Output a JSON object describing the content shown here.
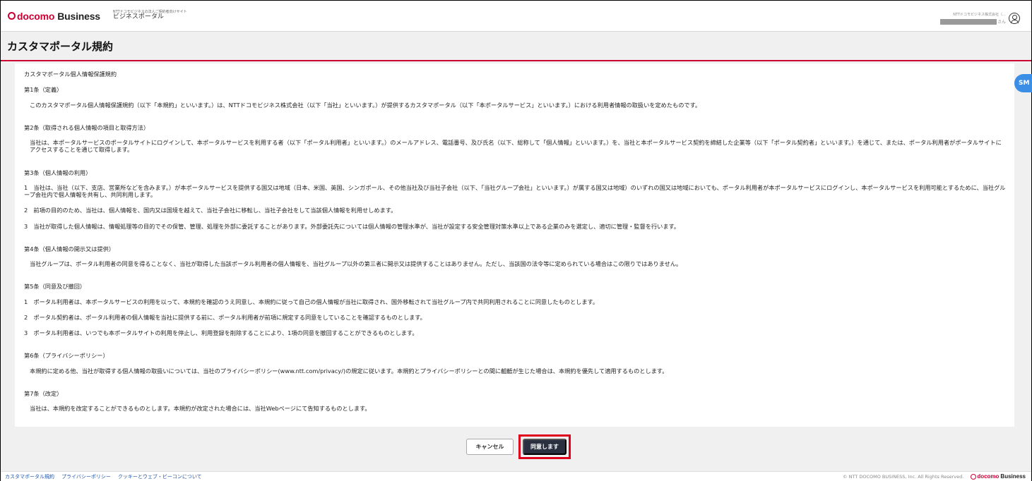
{
  "header": {
    "logo_brand": "docomo",
    "logo_business": "Business",
    "site_subtitle": "NTTドコモビジネスの法人ご契約者向けサイト",
    "site_title": "ビジネスポータル",
    "user_company": "NTTドコモビジネス株式会社（…",
    "user_suffix": "さん",
    "side_badge": "SM"
  },
  "page_title": "カスタマポータル規約",
  "terms": {
    "doc_title": "カスタマポータル個人情報保護規約",
    "art1_head": "第1条（定義）",
    "art1_body": "このカスタマポータル個人情報保護規約（以下「本規約」といいます。）は、NTTドコモビジネス株式会社（以下「当社」といいます。）が提供するカスタマポータル（以下「本ポータルサービス」といいます。）における利用者情報の取扱いを定めたものです。",
    "art2_head": "第2条（取得される個人情報の項目と取得方法）",
    "art2_body": "当社は、本ポータルサービスのポータルサイトにログインして、本ポータルサービスを利用する者（以下「ポータル利用者」といいます。）のメールアドレス、電話番号、及び氏名（以下、総称して「個人情報」といいます。）を、当社と本ポータルサービス契約を締結した企業等（以下「ポータル契約者」といいます。）を通じて、または、ポータル利用者がポータルサイトにアクセスすることを通じて取得します。",
    "art3_head": "第3条（個人情報の利用）",
    "art3_item1": "1　当社は、当社（以下、支店、営業所などを含みます。）が本ポータルサービスを提供する国又は地域（日本、米国、英国、シンガポール、その他当社及び当社子会社（以下、「当社グループ会社」といいます。）が属する国又は地域）のいずれの国又は地域においても、ポータル利用者が本ポータルサービスにログインし、本ポータルサービスを利用可能とするために、当社グループ会社内で個人情報を共有し、共同利用します。",
    "art3_item2": "2　前項の目的のため、当社は、個人情報を、国内又は国境を越えて、当社子会社に移転し、当社子会社をして当該個人情報を利用せしめます。",
    "art3_item3": "3　当社が取得した個人情報は、情報処理等の目的でその保管、管理、処理を外部に委託することがあります。外部委託先については個人情報の管理水準が、当社が設定する安全管理対策水準以上である企業のみを選定し、適切に管理・監督を行います。",
    "art4_head": "第4条（個人情報の開示又は提供）",
    "art4_body": "当社グループは、ポータル利用者の同意を得ることなく、当社が取得した当該ポータル利用者の個人情報を、当社グループ以外の第三者に開示又は提供することはありません。ただし、当該国の法令等に定められている場合はこの限りではありません。",
    "art5_head": "第5条（同意及び撤回）",
    "art5_item1": "1　ポータル利用者は、本ポータルサービスの利用を以って、本規約を確認のうえ同意し、本規約に従って自己の個人情報が当社に取得され、国外移転されて当社グループ内で共同利用されることに同意したものとします。",
    "art5_item2": "2　ポータル契約者は、ポータル利用者の個人情報を当社に提供する前に、ポータル利用者が前項に規定する同意をしていることを確認するものとします。",
    "art5_item3": "3　ポータル利用者は、いつでも本ポータルサイトの利用を停止し、利用登録を削除することにより、1項の同意を撤回することができるものとします。",
    "art6_head": "第6条（プライバシーポリシー）",
    "art6_body": "本規約に定める他、当社が取得する個人情報の取扱いについては、当社のプライバシーポリシー(www.ntt.com/privacy/)の規定に従います。本規約とプライバシーポリシーとの間に齟齬が生じた場合は、本規約を優先して適用するものとします。",
    "art7_head": "第7条（改定）",
    "art7_body": "当社は、本規約を改定することができるものとします。本規約が改定された場合には、当社Webページにて告知するものとします。"
  },
  "buttons": {
    "cancel": "キャンセル",
    "agree": "同意します"
  },
  "footer": {
    "links": [
      "カスタマポータル規約",
      "プライバシーポリシー",
      "クッキーとウェブ・ビーコンについて"
    ],
    "copyright": "© NTT DOCOMO BUSINESS, Inc. All Rights Reserved.",
    "logo_brand": "docomo",
    "logo_business": "Business"
  },
  "colors": {
    "brand_red": "#cc0033",
    "highlight_red": "#e0001b",
    "agree_button": "#2b3040",
    "link_blue": "#2255aa"
  }
}
